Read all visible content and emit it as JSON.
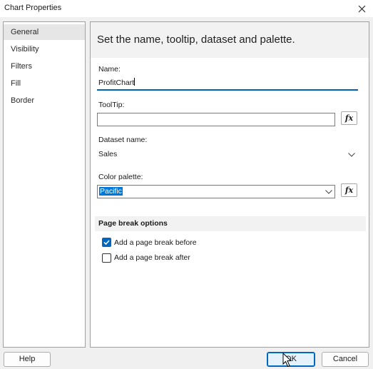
{
  "window": {
    "title": "Chart Properties",
    "close_icon": "close-icon"
  },
  "nav": {
    "items": [
      {
        "label": "General",
        "selected": true
      },
      {
        "label": "Visibility",
        "selected": false
      },
      {
        "label": "Filters",
        "selected": false
      },
      {
        "label": "Fill",
        "selected": false
      },
      {
        "label": "Border",
        "selected": false
      }
    ]
  },
  "main": {
    "header": "Set the name, tooltip, dataset and palette.",
    "name": {
      "label": "Name:",
      "value": "ProfitChart"
    },
    "tooltip": {
      "label": "ToolTip:",
      "value": "",
      "fx_label": "fx"
    },
    "dataset": {
      "label": "Dataset name:",
      "value": "Sales"
    },
    "palette": {
      "label": "Color palette:",
      "value": "Pacific",
      "fx_label": "fx"
    },
    "page_break": {
      "title": "Page break options",
      "before": {
        "label": "Add a page break before",
        "checked": true
      },
      "after": {
        "label": "Add a page break after",
        "checked": false
      }
    }
  },
  "footer": {
    "help_label": "Help",
    "ok_label": "OK",
    "cancel_label": "Cancel"
  },
  "colors": {
    "accent": "#0078d7",
    "checkbox_checked": "#0067c0",
    "background": "#f0f0f0"
  }
}
